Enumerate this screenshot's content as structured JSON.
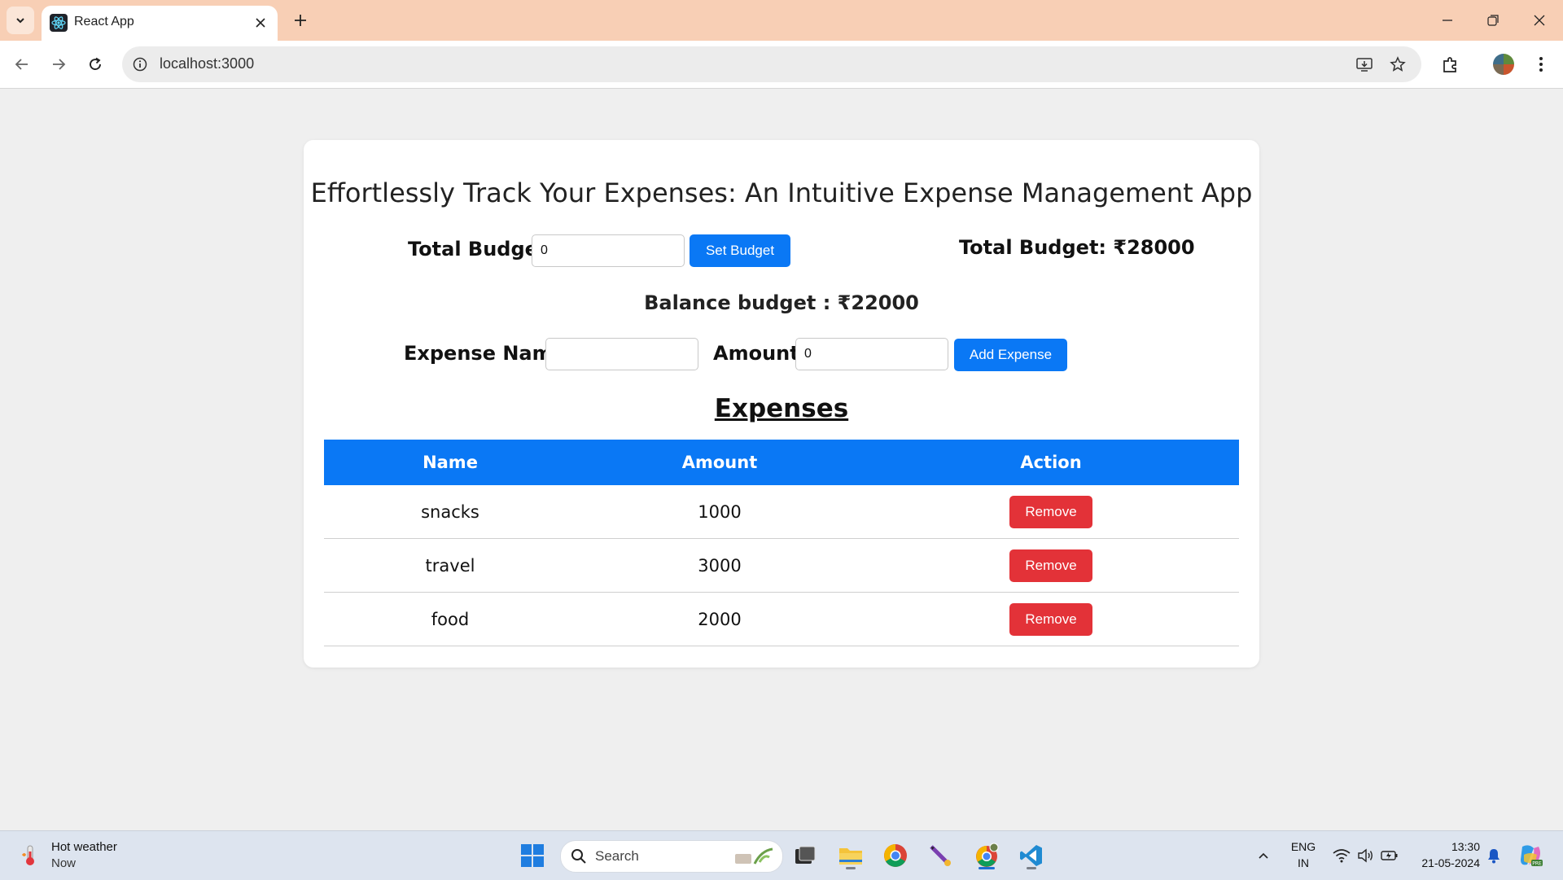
{
  "browser": {
    "tab_title": "React App",
    "url": "localhost:3000"
  },
  "app": {
    "title": "Effortlessly Track Your Expenses: An Intuitive Expense Management App",
    "budget_label": "Total Budget:",
    "budget_input_value": "0",
    "set_budget_label": "Set Budget",
    "total_budget_display": "Total Budget: ₹28000",
    "balance_display": "Balance budget : ₹22000",
    "expense_name_label": "Expense Name:",
    "expense_name_value": "",
    "amount_label": "Amount:",
    "amount_value": "0",
    "add_expense_label": "Add Expense",
    "expenses_heading": "Expenses",
    "table": {
      "columns": [
        "Name",
        "Amount",
        "Action"
      ],
      "rows": [
        {
          "name": "snacks",
          "amount": "1000",
          "action": "Remove"
        },
        {
          "name": "travel",
          "amount": "3000",
          "action": "Remove"
        },
        {
          "name": "food",
          "amount": "2000",
          "action": "Remove"
        }
      ]
    },
    "colors": {
      "primary": "#0a78f5",
      "danger": "#e33238"
    }
  },
  "taskbar": {
    "weather_title": "Hot weather",
    "weather_sub": "Now",
    "search_placeholder": "Search",
    "lang_line1": "ENG",
    "lang_line2": "IN",
    "time": "13:30",
    "date": "21-05-2024"
  }
}
